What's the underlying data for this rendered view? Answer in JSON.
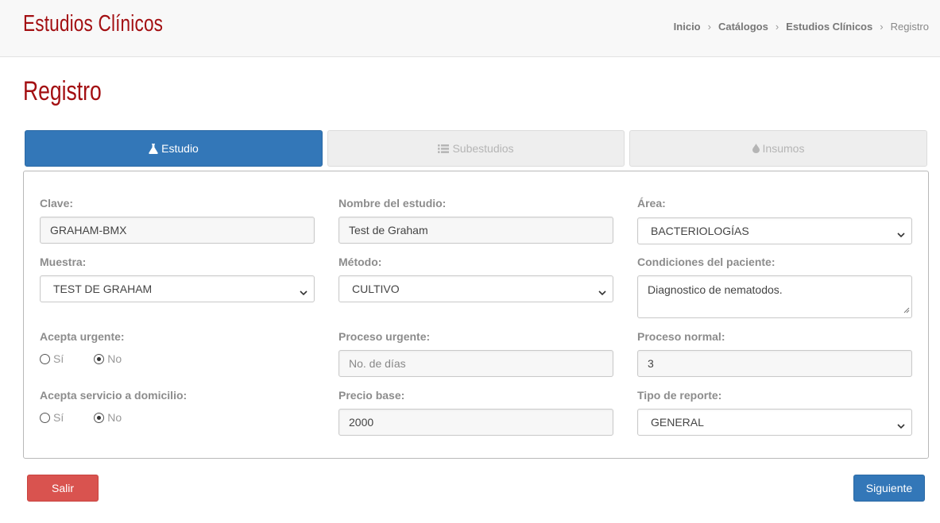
{
  "header": {
    "app_title": "Estudios Clínicos",
    "breadcrumb": [
      "Inicio",
      "Catálogos",
      "Estudios Clínicos",
      "Registro"
    ]
  },
  "page": {
    "title": "Registro"
  },
  "tabs": [
    {
      "label": "Estudio",
      "icon": "flask-icon",
      "state": "active"
    },
    {
      "label": "Subestudios",
      "icon": "list-icon",
      "state": "disabled"
    },
    {
      "label": "Insumos",
      "icon": "drop-icon",
      "state": "disabled"
    }
  ],
  "form": {
    "clave": {
      "label": "Clave:",
      "value": "GRAHAM-BMX"
    },
    "nombre": {
      "label": "Nombre del estudio:",
      "value": "Test de Graham"
    },
    "area": {
      "label": "Área:",
      "value": "BACTERIOLOGÍAS"
    },
    "muestra": {
      "label": "Muestra:",
      "value": "TEST DE GRAHAM"
    },
    "metodo": {
      "label": "Método:",
      "value": "CULTIVO"
    },
    "condiciones": {
      "label": "Condiciones del paciente:",
      "value": "Diagnostico de nematodos."
    },
    "acepta_urgente": {
      "label": "Acepta urgente:",
      "options": [
        "Sí",
        "No"
      ],
      "selected": "No"
    },
    "proceso_urgente": {
      "label": "Proceso urgente:",
      "placeholder": "No. de días",
      "value": ""
    },
    "proceso_normal": {
      "label": "Proceso normal:",
      "value": "3"
    },
    "acepta_domicilio": {
      "label": "Acepta servicio a domicilio:",
      "options": [
        "Sí",
        "No"
      ],
      "selected": "No"
    },
    "precio_base": {
      "label": "Precio base:",
      "value": "2000"
    },
    "tipo_reporte": {
      "label": "Tipo de reporte:",
      "value": "GENERAL"
    }
  },
  "buttons": {
    "exit": "Salir",
    "next": "Siguiente"
  },
  "colors": {
    "brand": "#a30f12",
    "primary": "#3377b8",
    "danger": "#d9534f"
  }
}
